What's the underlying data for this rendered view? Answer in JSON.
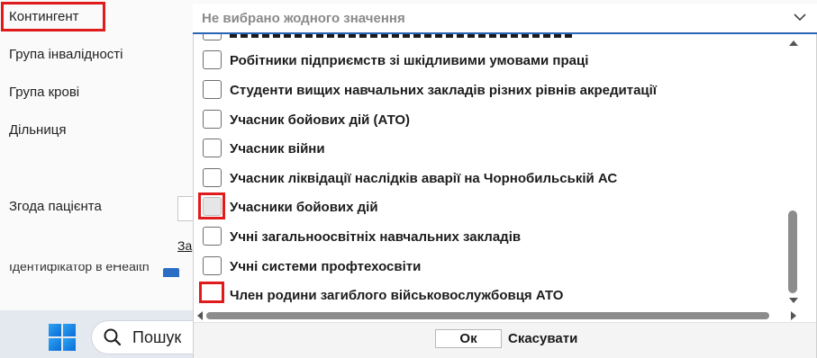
{
  "form": {
    "labels": {
      "contingent": "Контингент",
      "disability_group": "Група інвалідності",
      "blood_group": "Група крові",
      "district": "Дільниця",
      "patient_consent": "Згода пацієнта",
      "consent_link": "За",
      "ehealth_id": "Ідентифікатор в eHealth"
    }
  },
  "contingent_select": {
    "placeholder": "Не вибрано жодного значення",
    "options": [
      {
        "label": "Робітники підприємств зі шкідливими умовами праці",
        "checked": false
      },
      {
        "label": "Студенти вищих навчальних закладів різних рівнів акредитації",
        "checked": false
      },
      {
        "label": "Учасник бойових дій (АТО)",
        "checked": false
      },
      {
        "label": "Учасник війни",
        "checked": false
      },
      {
        "label": "Учасник ліквідації наслідків аварії на Чорнобильській АС",
        "checked": false
      },
      {
        "label": "Учасники бойових дій",
        "checked": false
      },
      {
        "label": "Учні загальноосвітніх навчальних закладів",
        "checked": false
      },
      {
        "label": "Учні системи профтехосвіти",
        "checked": false
      },
      {
        "label": "Член родини загиблого військовослужбовця АТО",
        "checked": false
      }
    ],
    "ok_label": "Ок",
    "cancel_label": "Скасувати"
  },
  "taskbar": {
    "search_text": "Пошук"
  },
  "colors": {
    "highlight": "#e01b1b",
    "focus_border": "#2a64b5"
  },
  "icons": [
    "chevron-down-icon",
    "windows-start-icon",
    "search-icon",
    "scroll-up-icon",
    "scroll-down-icon",
    "scroll-left-icon",
    "scroll-right-icon",
    "ehealth-icon"
  ]
}
